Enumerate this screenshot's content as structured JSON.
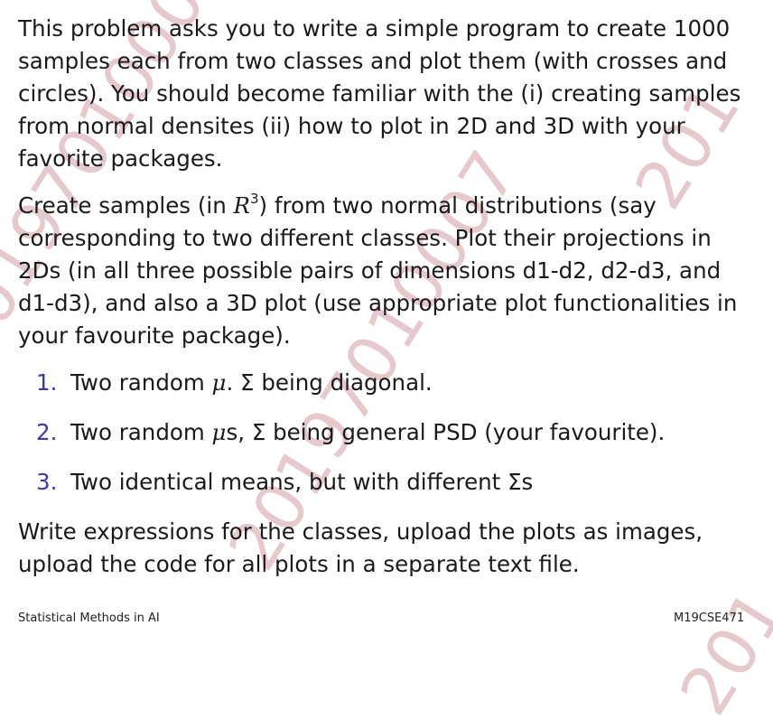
{
  "watermark": "20197010007",
  "watermark_partial": "201",
  "paragraphs": {
    "p1": "This problem asks you to write a simple program to create 1000 samples each from two classes and plot them (with crosses and circles). You should become familiar with the (i) creating samples from normal densites (ii) how to plot in 2D and 3D with your favorite packages.",
    "p2_before": "Create samples (in ",
    "p2_var": "R",
    "p2_sup": "3",
    "p2_after": ") from two normal distributions (say corresponding to two different classes. Plot their projections in 2Ds (in all three possible pairs of dimensions d1-d2, d2-d3, and d1-d3), and also a 3D plot (use appropriate plot functionalities in your favourite package).",
    "p3": "Write expressions for the classes, upload the plots as images, upload the code for all plots in a separate text file."
  },
  "list": [
    {
      "num": "1.",
      "before": "Two random ",
      "mu": "μ",
      "after": ". Σ being diagonal."
    },
    {
      "num": "2.",
      "before": "Two random ",
      "mu": "μ",
      "after": "s, Σ being general PSD (your favourite)."
    },
    {
      "num": "3.",
      "before": "Two identical means, but with different Σs",
      "mu": "",
      "after": ""
    }
  ],
  "footer": {
    "left": "Statistical Methods in AI",
    "right": "M19CSE471"
  }
}
